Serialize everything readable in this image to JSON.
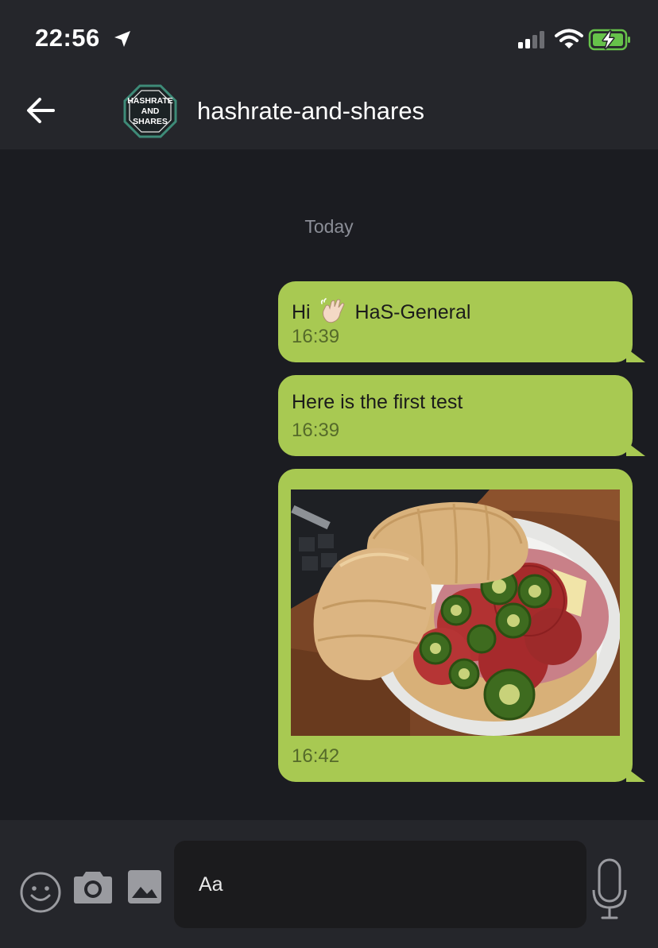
{
  "status_bar": {
    "time": "22:56",
    "icons": [
      "location-arrow-icon",
      "cellular-signal-icon",
      "wifi-icon",
      "battery-charging-icon"
    ]
  },
  "header": {
    "back_icon": "arrow-left-icon",
    "avatar_lines": [
      "HASHRATE",
      "AND",
      "SHARES"
    ],
    "title": "hashrate-and-shares"
  },
  "chat": {
    "date_separator": "Today",
    "messages": [
      {
        "text_before": "Hi",
        "emoji": "waving-hand-icon",
        "text_after": "HaS-General",
        "time": "16:39"
      },
      {
        "text": "Here is the first test",
        "time": "16:39"
      },
      {
        "image": "sandwich-photo",
        "time": "16:42"
      }
    ]
  },
  "composer": {
    "placeholder": "Aa",
    "icons": [
      "smiley-icon",
      "camera-icon",
      "image-gallery-icon",
      "microphone-icon"
    ]
  },
  "colors": {
    "background": "#1b1c21",
    "bar": "#25262b",
    "bubble": "#a8c952",
    "timestamp": "#556a2a",
    "separator_text": "#8b8e97"
  }
}
